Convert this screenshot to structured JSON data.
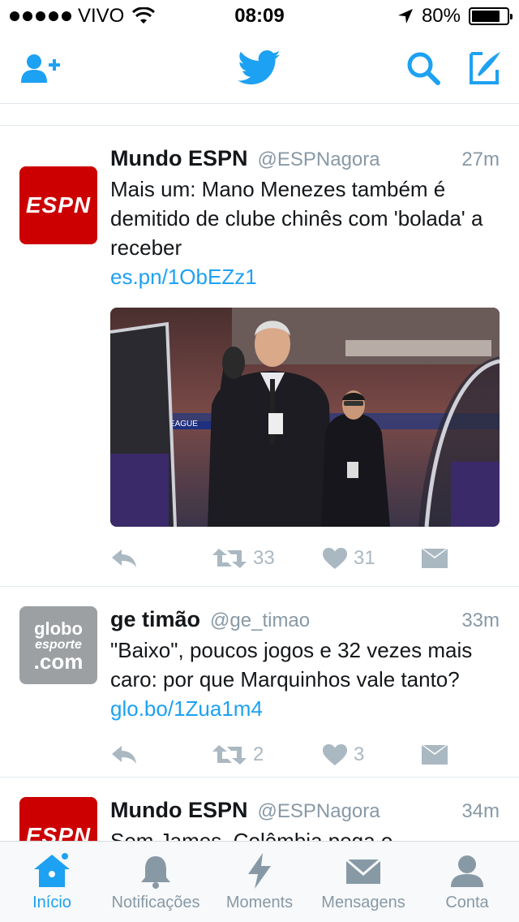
{
  "status_bar": {
    "carrier": "VIVO",
    "time": "08:09",
    "battery": "80%",
    "battery_fraction": 0.8
  },
  "nav": {
    "icons": [
      "add-user-icon",
      "twitter-bird-icon",
      "search-icon",
      "compose-icon"
    ]
  },
  "tweets": [
    {
      "name": "Mundo ESPN",
      "handle": "@ESPNagora",
      "time": "27m",
      "avatar_text": "ESPN",
      "text": "Mais um: Mano Menezes também é demitido de clube chinês com 'bolada' a receber",
      "link": "es.pn/1ObEZz1",
      "has_media": true,
      "media_text": "CHAMPIONS LEAGUE",
      "retweets": "33",
      "likes": "31"
    },
    {
      "name": "ge timão",
      "handle": "@ge_timao",
      "time": "33m",
      "avatar_text_1": "globo",
      "avatar_text_2": "esporte",
      "avatar_text_3": ".com",
      "text": "\"Baixo\", poucos jogos e 32 vezes mais caro: por que Marquinhos vale tanto?",
      "link": "glo.bo/1Zua1m4",
      "has_media": false,
      "retweets": "2",
      "likes": "3"
    },
    {
      "name": "Mundo ESPN",
      "handle": "@ESPNagora",
      "time": "34m",
      "avatar_text": "ESPN",
      "text": "Sem James, Colômbia pega o"
    }
  ],
  "tabs": [
    {
      "label": "Início",
      "icon": "home-icon",
      "active": true
    },
    {
      "label": "Notificações",
      "icon": "bell-icon",
      "active": false
    },
    {
      "label": "Moments",
      "icon": "lightning-icon",
      "active": false
    },
    {
      "label": "Mensagens",
      "icon": "envelope-icon",
      "active": false
    },
    {
      "label": "Conta",
      "icon": "person-icon",
      "active": false
    }
  ],
  "colors": {
    "accent": "#1da1f2",
    "espn_red": "#cc0000",
    "muted": "#8899a6",
    "action_gray": "#aab8c2"
  }
}
